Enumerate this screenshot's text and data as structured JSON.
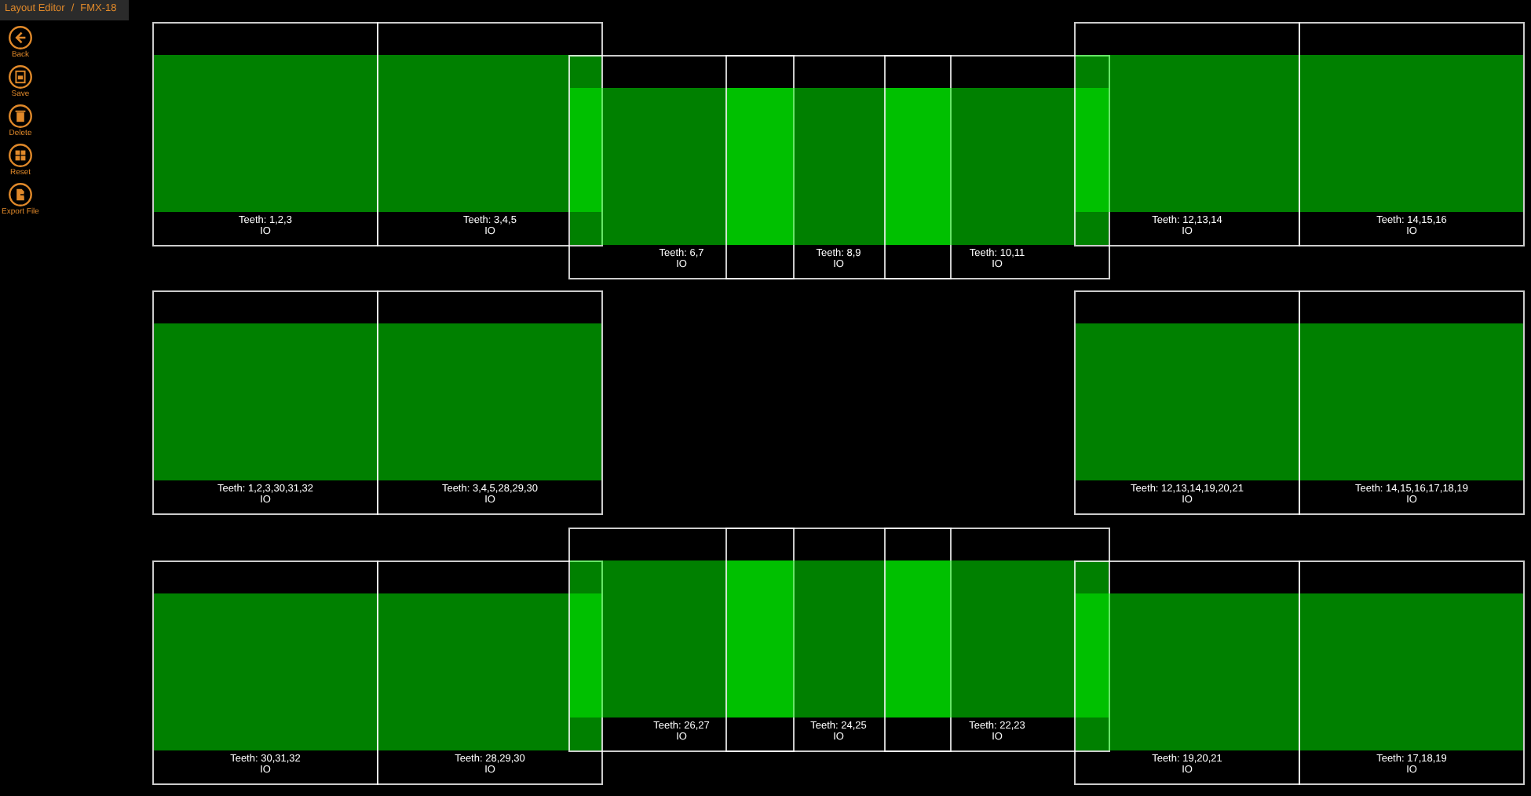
{
  "breadcrumb": {
    "section": "Layout Editor",
    "separator": "/",
    "item": "FMX-18"
  },
  "toolbar": [
    {
      "kind": "back",
      "label": "Back"
    },
    {
      "kind": "save",
      "label": "Save"
    },
    {
      "kind": "delete",
      "label": "Delete"
    },
    {
      "kind": "reset",
      "label": "Reset"
    },
    {
      "kind": "export",
      "label": "Export File"
    }
  ],
  "tiles": [
    {
      "teeth": "Teeth: 1,2,3",
      "mode": "IO"
    },
    {
      "teeth": "Teeth: 3,4,5",
      "mode": "IO"
    },
    {
      "teeth": "Teeth: 6,7",
      "mode": "IO"
    },
    {
      "teeth": "Teeth: 8,9",
      "mode": "IO"
    },
    {
      "teeth": "Teeth: 10,11",
      "mode": "IO"
    },
    {
      "teeth": "Teeth: 12,13,14",
      "mode": "IO"
    },
    {
      "teeth": "Teeth: 14,15,16",
      "mode": "IO"
    },
    {
      "teeth": "Teeth: 1,2,3,30,31,32",
      "mode": "IO"
    },
    {
      "teeth": "Teeth: 3,4,5,28,29,30",
      "mode": "IO"
    },
    {
      "teeth": "Teeth: 12,13,14,19,20,21",
      "mode": "IO"
    },
    {
      "teeth": "Teeth: 14,15,16,17,18,19",
      "mode": "IO"
    },
    {
      "teeth": "Teeth: 30,31,32",
      "mode": "IO"
    },
    {
      "teeth": "Teeth: 28,29,30",
      "mode": "IO"
    },
    {
      "teeth": "Teeth: 26,27",
      "mode": "IO"
    },
    {
      "teeth": "Teeth: 24,25",
      "mode": "IO"
    },
    {
      "teeth": "Teeth: 22,23",
      "mode": "IO"
    },
    {
      "teeth": "Teeth: 19,20,21",
      "mode": "IO"
    },
    {
      "teeth": "Teeth: 17,18,19",
      "mode": "IO"
    }
  ]
}
